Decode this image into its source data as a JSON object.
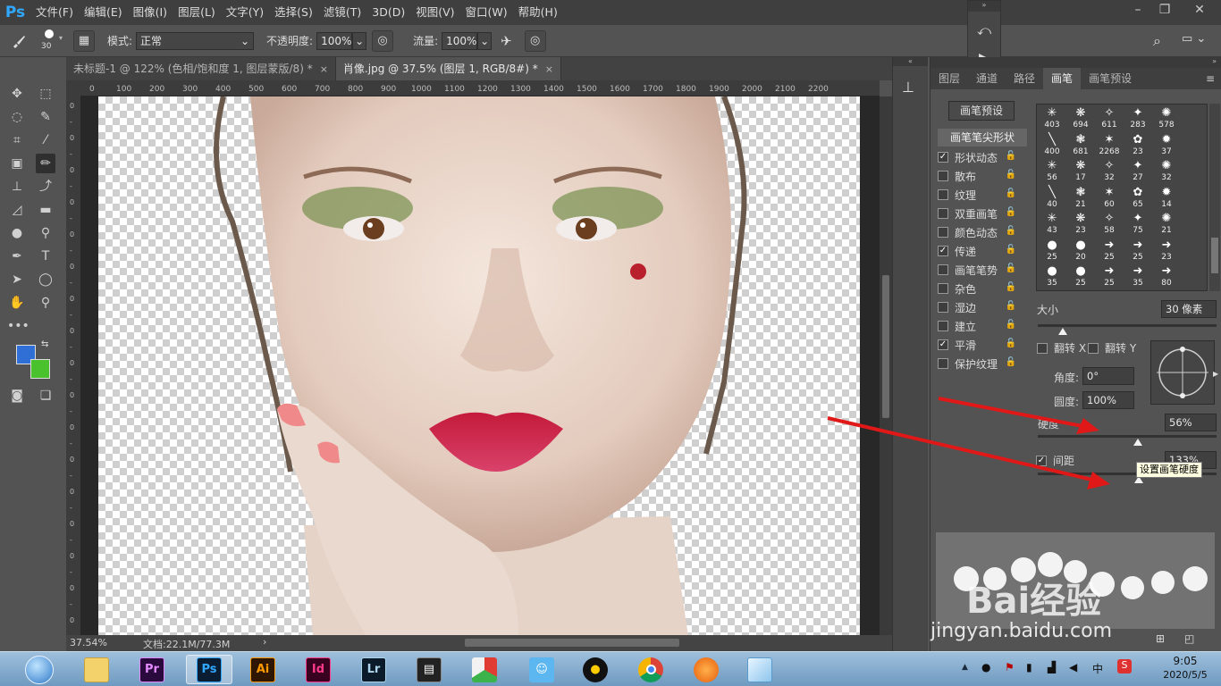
{
  "app": {
    "logo": "Ps"
  },
  "menu": [
    "文件(F)",
    "编辑(E)",
    "图像(I)",
    "图层(L)",
    "文字(Y)",
    "选择(S)",
    "滤镜(T)",
    "3D(D)",
    "视图(V)",
    "窗口(W)",
    "帮助(H)"
  ],
  "options": {
    "brush_size": "30",
    "mode_label": "模式:",
    "mode_value": "正常",
    "opacity_label": "不透明度:",
    "opacity_value": "100%",
    "flow_label": "流量:",
    "flow_value": "100%"
  },
  "tabs": [
    {
      "label": "未标题-1 @ 122% (色相/饱和度 1, 图层蒙版/8) *",
      "close": "×"
    },
    {
      "label": "肖像.jpg @ 37.5% (图层 1, RGB/8#) *",
      "close": "×"
    }
  ],
  "ruler": [
    "0",
    "100",
    "200",
    "300",
    "400",
    "500",
    "600",
    "700",
    "800",
    "900",
    "1000",
    "1100",
    "1200",
    "1300",
    "1400",
    "1500",
    "1600",
    "1700",
    "1800",
    "1900",
    "2000",
    "2100",
    "2200"
  ],
  "status": {
    "zoom": "37.54%",
    "doc": "文档:22.1M/77.3M"
  },
  "panel": {
    "tabs": [
      "图层",
      "通道",
      "路径",
      "画笔",
      "画笔预设"
    ],
    "preset_button": "画笔预设",
    "tip_shape": "画笔笔尖形状",
    "options": [
      {
        "label": "形状动态",
        "checked": true
      },
      {
        "label": "散布",
        "checked": false
      },
      {
        "label": "纹理",
        "checked": false
      },
      {
        "label": "双重画笔",
        "checked": false
      },
      {
        "label": "颜色动态",
        "checked": false
      },
      {
        "label": "传递",
        "checked": true
      },
      {
        "label": "画笔笔势",
        "checked": false
      },
      {
        "label": "杂色",
        "checked": false
      },
      {
        "label": "湿边",
        "checked": false
      },
      {
        "label": "建立",
        "checked": false
      },
      {
        "label": "平滑",
        "checked": true
      },
      {
        "label": "保护纹理",
        "checked": false
      }
    ],
    "brush_sizes": [
      "403",
      "694",
      "611",
      "283",
      "578",
      "400",
      "681",
      "2268",
      "23",
      "37",
      "56",
      "17",
      "32",
      "27",
      "32",
      "40",
      "21",
      "60",
      "65",
      "14",
      "43",
      "23",
      "58",
      "75",
      "21",
      "25",
      "20",
      "25",
      "25",
      "23",
      "35",
      "25",
      "25",
      "35",
      "80"
    ],
    "size_label": "大小",
    "size_value": "30 像素",
    "flip_x": "翻转 X",
    "flip_y": "翻转 Y",
    "angle_label": "角度:",
    "angle_value": "0°",
    "roundness_label": "圆度:",
    "roundness_value": "100%",
    "hardness_label": "硬度",
    "hardness_value": "56%",
    "hardness_level": 0.56,
    "spacing_label": "间距",
    "spacing_value": "133%",
    "tooltip": "设置画笔硬度"
  },
  "watermark": {
    "brand": "Bai经验",
    "url": "jingyan.baidu.com"
  },
  "taskbar": {
    "apps": [
      "Pr",
      "Ps",
      "Ai",
      "Id",
      "Lr"
    ],
    "time": "9:05",
    "date": "2020/5/5",
    "ime": "中"
  },
  "colors": {
    "foreground": "#2f6fd6",
    "background": "#4ac22e",
    "ps_blue": "#31a8ff"
  }
}
